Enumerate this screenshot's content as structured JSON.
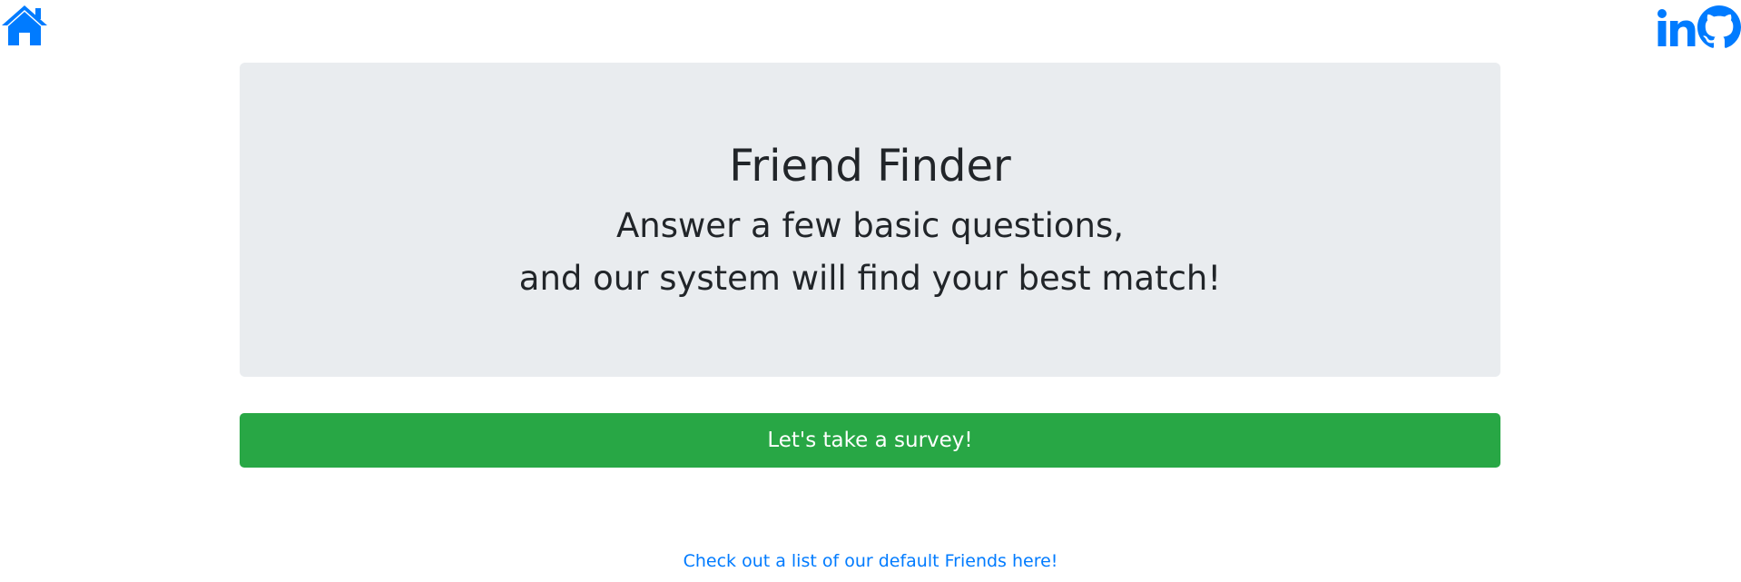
{
  "nav": {
    "home_icon": "home-icon",
    "linkedin_icon": "linkedin-icon",
    "github_icon": "github-icon",
    "brand_color": "#007bff"
  },
  "jumbotron": {
    "title": "Friend Finder",
    "subtitle_line1": "Answer a few basic questions,",
    "subtitle_line2": "and our system will find your best match!",
    "background": "#e9ecef"
  },
  "survey_button": {
    "label": "Let's take a survey!",
    "color": "#28a745"
  },
  "friends_link": {
    "label": "Check out a list of our default Friends here!"
  }
}
